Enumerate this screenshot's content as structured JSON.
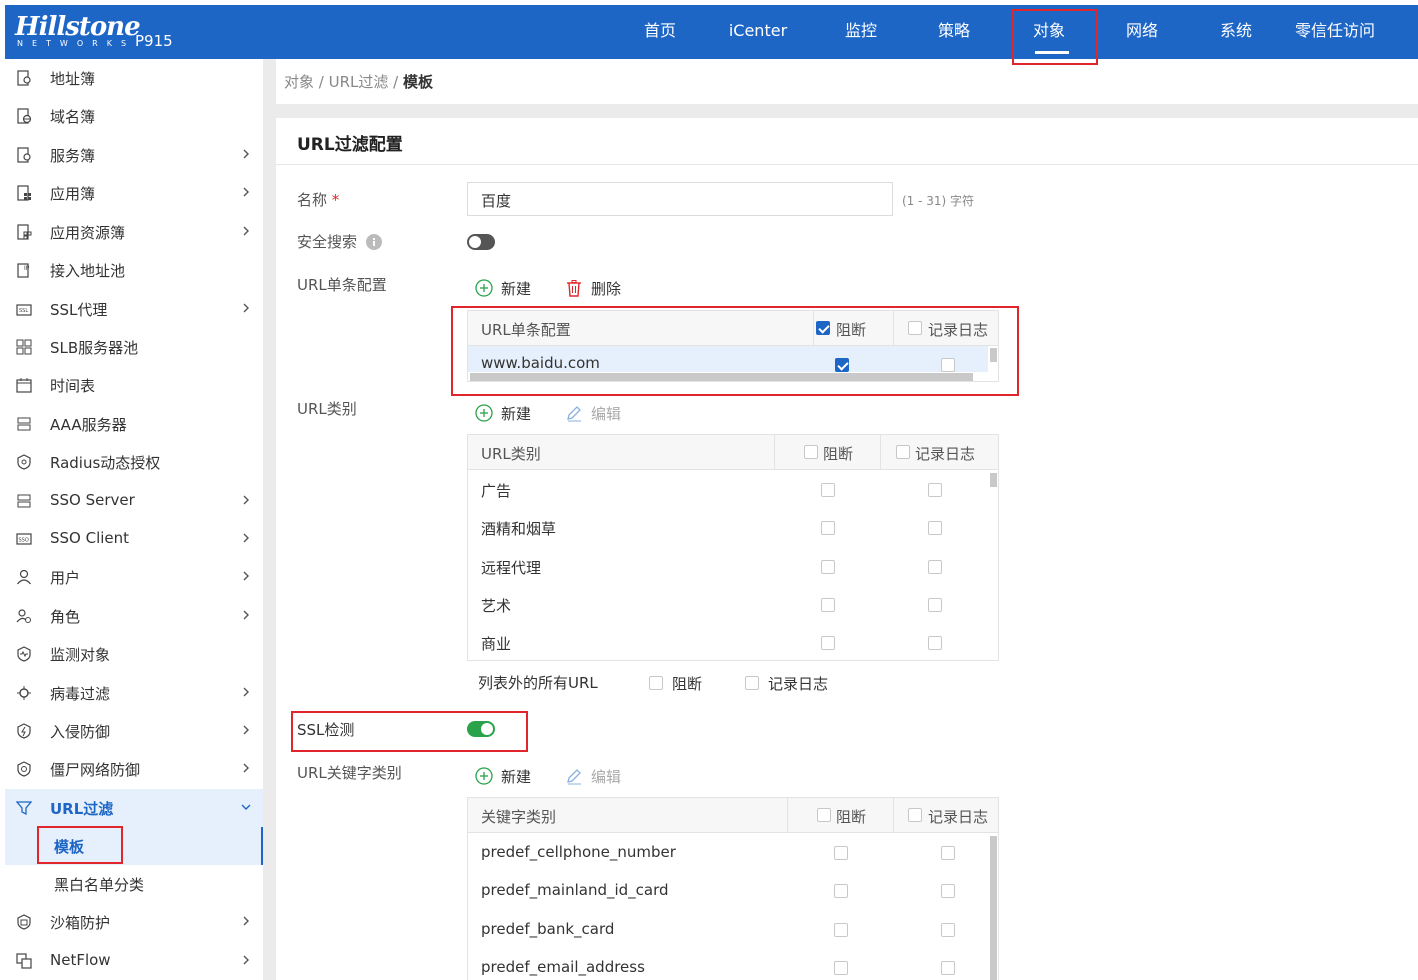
{
  "header": {
    "logo": "Hillstone",
    "logo_sub": "NETWORKS",
    "model": "P915",
    "nav": [
      "首页",
      "iCenter",
      "监控",
      "策略",
      "对象",
      "网络",
      "系统",
      "零信任访问"
    ],
    "active_nav": "对象"
  },
  "sidebar": {
    "items": [
      {
        "label": "地址簿",
        "icon": "address-book-icon",
        "chevron": false
      },
      {
        "label": "域名簿",
        "icon": "domain-book-icon",
        "chevron": false
      },
      {
        "label": "服务簿",
        "icon": "service-book-icon",
        "chevron": true
      },
      {
        "label": "应用簿",
        "icon": "app-book-icon",
        "chevron": true
      },
      {
        "label": "应用资源簿",
        "icon": "app-resource-icon",
        "chevron": true
      },
      {
        "label": "接入地址池",
        "icon": "ip-pool-icon",
        "chevron": false
      },
      {
        "label": "SSL代理",
        "icon": "ssl-proxy-icon",
        "chevron": true
      },
      {
        "label": "SLB服务器池",
        "icon": "slb-pool-icon",
        "chevron": false
      },
      {
        "label": "时间表",
        "icon": "calendar-icon",
        "chevron": false
      },
      {
        "label": "AAA服务器",
        "icon": "aaa-server-icon",
        "chevron": false
      },
      {
        "label": "Radius动态授权",
        "icon": "radius-icon",
        "chevron": false
      },
      {
        "label": "SSO Server",
        "icon": "sso-server-icon",
        "chevron": true
      },
      {
        "label": "SSO Client",
        "icon": "sso-client-icon",
        "chevron": true
      },
      {
        "label": "用户",
        "icon": "user-icon",
        "chevron": true
      },
      {
        "label": "角色",
        "icon": "role-icon",
        "chevron": true
      },
      {
        "label": "监测对象",
        "icon": "monitor-object-icon",
        "chevron": false
      },
      {
        "label": "病毒过滤",
        "icon": "virus-filter-icon",
        "chevron": true
      },
      {
        "label": "入侵防御",
        "icon": "ips-shield-icon",
        "chevron": true
      },
      {
        "label": "僵尸网络防御",
        "icon": "botnet-shield-icon",
        "chevron": true
      },
      {
        "label": "URL过滤",
        "icon": "url-filter-icon",
        "chevron": true,
        "expanded": true
      }
    ],
    "sub_items": [
      "模板",
      "黑白名单分类"
    ],
    "after_items": [
      {
        "label": "沙箱防护",
        "icon": "sandbox-icon",
        "chevron": true
      },
      {
        "label": "NetFlow",
        "icon": "netflow-icon",
        "chevron": true
      }
    ]
  },
  "breadcrumb": {
    "path": "对象 / URL过滤 / ",
    "current": "模板"
  },
  "form": {
    "title": "URL过滤配置",
    "name_label": "名称",
    "name_required": "*",
    "name_value": "百度",
    "name_hint": "(1 - 31) 字符",
    "safe_search_label": "安全搜索",
    "safe_search_on": false,
    "url_entry_label": "URL单条配置",
    "url_category_label": "URL类别",
    "ssl_label": "SSL检测",
    "ssl_on": true,
    "keyword_label": "URL关键字类别"
  },
  "buttons": {
    "new": "新建",
    "delete": "删除",
    "edit": "编辑"
  },
  "url_entry_table": {
    "headers": [
      "URL单条配置",
      "阻断",
      "记录日志"
    ],
    "header_block_checked": true,
    "header_log_checked": false,
    "rows": [
      {
        "url": "www.baidu.com",
        "block": true,
        "log": false
      }
    ]
  },
  "url_category_table": {
    "headers": [
      "URL类别",
      "阻断",
      "记录日志"
    ],
    "rows": [
      "广告",
      "酒精和烟草",
      "远程代理",
      "艺术",
      "商业"
    ]
  },
  "all_urls": {
    "label": "列表外的所有URL",
    "block": "阻断",
    "log": "记录日志"
  },
  "keyword_table": {
    "headers": [
      "关键字类别",
      "阻断",
      "记录日志"
    ],
    "rows": [
      "predef_cellphone_number",
      "predef_mainland_id_card",
      "predef_bank_card",
      "predef_email_address"
    ]
  },
  "colors": {
    "brand": "#1e66c6",
    "highlight": "#e0262b",
    "toggle_on": "#2aa24a",
    "toggle_off": "#555555"
  }
}
